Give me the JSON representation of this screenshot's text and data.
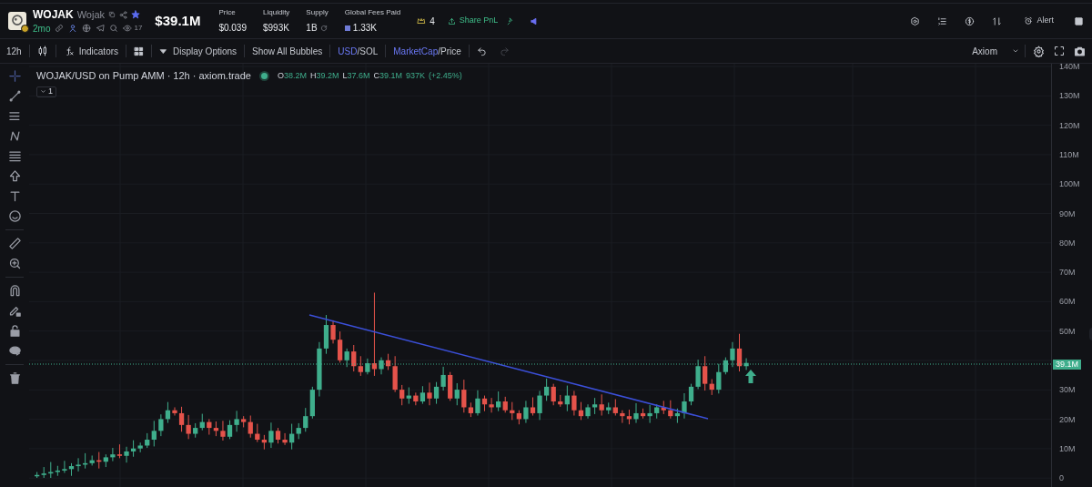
{
  "header": {
    "symbol": "WOJAK",
    "name": "Wojak",
    "age": "2mo",
    "views": "17",
    "market_cap": "$39.1M",
    "stats": [
      {
        "label": "Price",
        "value": "$0.039",
        "kind": "plain"
      },
      {
        "label": "Liquidity",
        "value": "$993K",
        "kind": "plain"
      },
      {
        "label": "Supply",
        "value": "1B",
        "kind": "refresh"
      },
      {
        "label": "Global Fees Paid",
        "value": "1.33K",
        "kind": "fees"
      }
    ],
    "holders": "4",
    "share": "Share PnL",
    "alert": "Alert"
  },
  "toolbar": {
    "interval": "12h",
    "indicators": "Indicators",
    "display": "Display Options",
    "bubbles": "Show All Bubbles",
    "currency": [
      {
        "label": "USD",
        "selected": true
      },
      {
        "label": "SOL",
        "selected": false
      }
    ],
    "mode": [
      {
        "label": "MarketCap",
        "selected": true
      },
      {
        "label": "Price",
        "selected": false
      }
    ],
    "separator": "/",
    "undo_disabled": false,
    "redo_disabled": true,
    "theme": "Axiom"
  },
  "legend": {
    "title": "WOJAK/USD on Pump AMM · 12h · axiom.trade",
    "ohlc": [
      {
        "key": "O",
        "value": "38.2M"
      },
      {
        "key": "H",
        "value": "39.2M"
      },
      {
        "key": "L",
        "value": "37.6M"
      },
      {
        "key": "C",
        "value": "39.1M"
      }
    ],
    "volume": "937K",
    "change": "(+2.45%)",
    "indicator_count": "1"
  },
  "y_axis": {
    "ticks": [
      "140M",
      "130M",
      "120M",
      "110M",
      "100M",
      "90M",
      "80M",
      "70M",
      "60M",
      "50M",
      "30M",
      "20M",
      "10M",
      "0"
    ],
    "last_price": "39.1M"
  }
}
